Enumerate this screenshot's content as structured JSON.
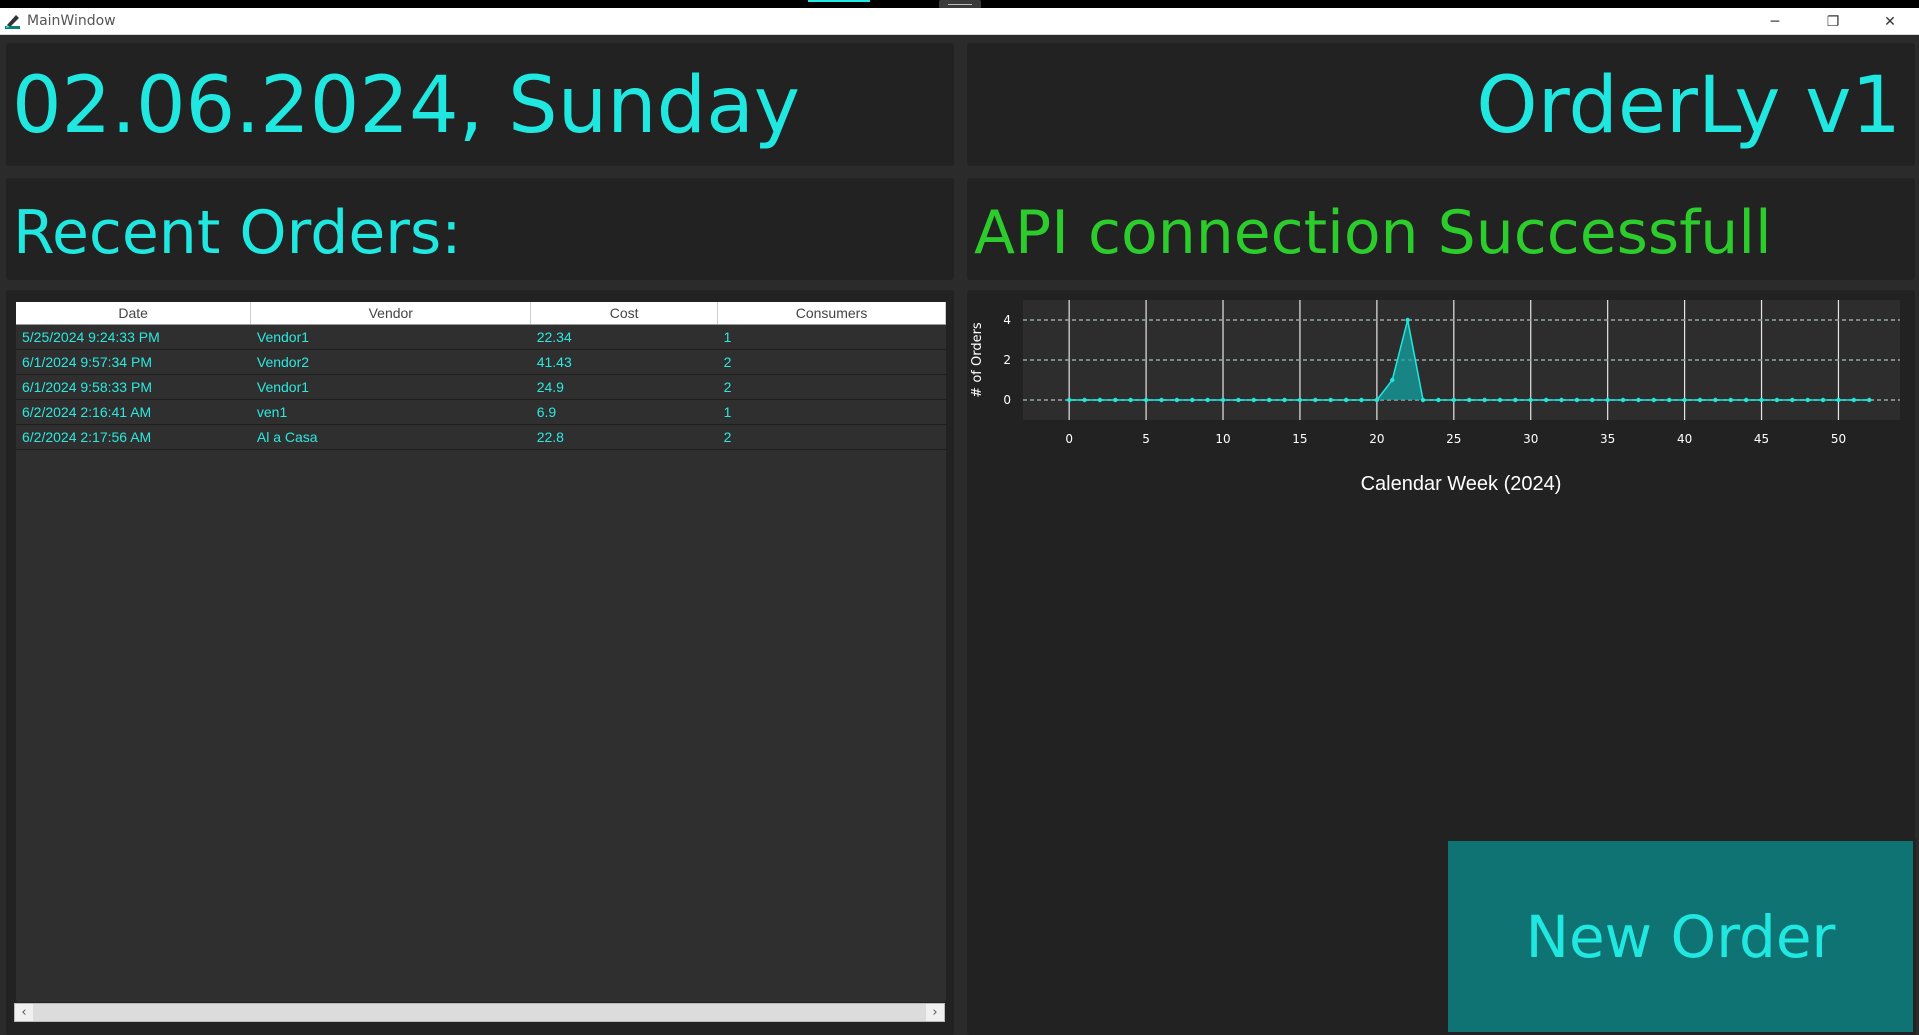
{
  "window": {
    "title": "MainWindow",
    "minimize": "─",
    "restore": "❐",
    "close": "✕"
  },
  "header": {
    "date_text": "02.06.2024, Sunday",
    "app_name": "OrderLy v1"
  },
  "recent_orders": {
    "heading": "Recent Orders:"
  },
  "api_status": {
    "text": "API connection Successfull",
    "color": "#2ccc2c"
  },
  "table": {
    "columns": [
      "Date",
      "Vendor",
      "Cost",
      "Consumers"
    ],
    "rows": [
      [
        "5/25/2024 9:24:33 PM",
        "Vendor1",
        "22.34",
        "1"
      ],
      [
        "6/1/2024 9:57:34 PM",
        "Vendor2",
        "41.43",
        "2"
      ],
      [
        "6/1/2024 9:58:33 PM",
        "Vendor1",
        "24.9",
        "2"
      ],
      [
        "6/2/2024 2:16:41 AM",
        "ven1",
        "6.9",
        "1"
      ],
      [
        "6/2/2024 2:17:56 AM",
        "Al a Casa",
        "22.8",
        "2"
      ]
    ]
  },
  "scrollbar": {
    "left_arrow": "‹",
    "right_arrow": "›"
  },
  "new_order_button": {
    "label": "New Order"
  },
  "colors": {
    "accent": "#20e8e0",
    "button_bg": "#0e7372",
    "panel_bg": "#222222",
    "window_bg": "#2b2b2b"
  },
  "chart_data": {
    "type": "area",
    "xlabel": "Calendar Week (2024)",
    "ylabel": "# of Orders",
    "xlim": [
      -3,
      54
    ],
    "ylim": [
      -1,
      5
    ],
    "x_ticks": [
      0,
      5,
      10,
      15,
      20,
      25,
      30,
      35,
      40,
      45,
      50
    ],
    "y_ticks": [
      0,
      2,
      4
    ],
    "grid": "vertical solid, horizontal dashed",
    "x": [
      0,
      1,
      2,
      3,
      4,
      5,
      6,
      7,
      8,
      9,
      10,
      11,
      12,
      13,
      14,
      15,
      16,
      17,
      18,
      19,
      20,
      21,
      22,
      23,
      24,
      25,
      26,
      27,
      28,
      29,
      30,
      31,
      32,
      33,
      34,
      35,
      36,
      37,
      38,
      39,
      40,
      41,
      42,
      43,
      44,
      45,
      46,
      47,
      48,
      49,
      50,
      51,
      52
    ],
    "values": [
      0,
      0,
      0,
      0,
      0,
      0,
      0,
      0,
      0,
      0,
      0,
      0,
      0,
      0,
      0,
      0,
      0,
      0,
      0,
      0,
      0,
      1,
      4,
      0,
      0,
      0,
      0,
      0,
      0,
      0,
      0,
      0,
      0,
      0,
      0,
      0,
      0,
      0,
      0,
      0,
      0,
      0,
      0,
      0,
      0,
      0,
      0,
      0,
      0,
      0,
      0,
      0,
      0
    ]
  }
}
